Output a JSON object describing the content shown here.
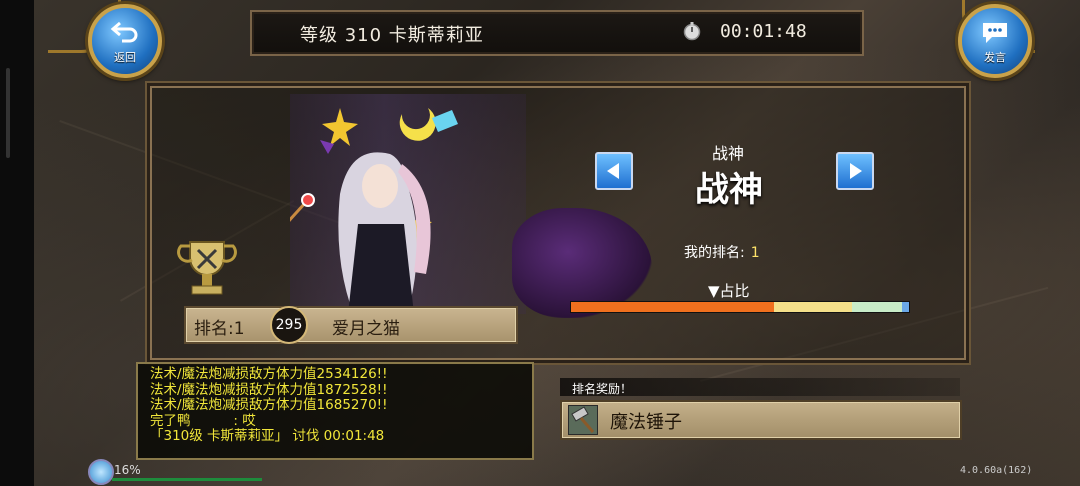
{
  "header": {
    "title": "等级 310 卡斯蒂莉亚",
    "timer": "00:01:48"
  },
  "buttons": {
    "back_label": "返回",
    "chat_label": "发言"
  },
  "player_card": {
    "rank_text": "排名:1",
    "level": "295",
    "player_name": "爱月之猫"
  },
  "title_panel": {
    "title_small": "战神",
    "title_big": "战神",
    "my_rank_label": "我的排名:",
    "my_rank_value": "1",
    "ratio_label": "▼占比",
    "ratio_segments": [
      {
        "fraction": 0.6,
        "color": "#f0701e"
      },
      {
        "fraction": 0.23,
        "color": "#f4e08a"
      },
      {
        "fraction": 0.15,
        "color": "#c8ecc8"
      },
      {
        "fraction": 0.02,
        "color": "#6aa8e8"
      }
    ]
  },
  "chat_log": {
    "lines": [
      "法术/魔法炮减损敌方体力值2534126!!",
      "法术/魔法炮减损敌方体力值1872528!!",
      "法术/魔法炮减损敌方体力值1685270!!",
      "完了鸭          : 哎",
      "「310级 卡斯蒂莉亚」 讨伐 00:01:48"
    ]
  },
  "reward": {
    "label": "排名奖励！",
    "item_name": "魔法锤子"
  },
  "status": {
    "percent": "16%",
    "version": "4.0.60a(162)"
  },
  "colors": {
    "frame_gold": "#c9a24a",
    "chat_text": "#f1e63a",
    "button_blue": "#1f6fd0"
  }
}
